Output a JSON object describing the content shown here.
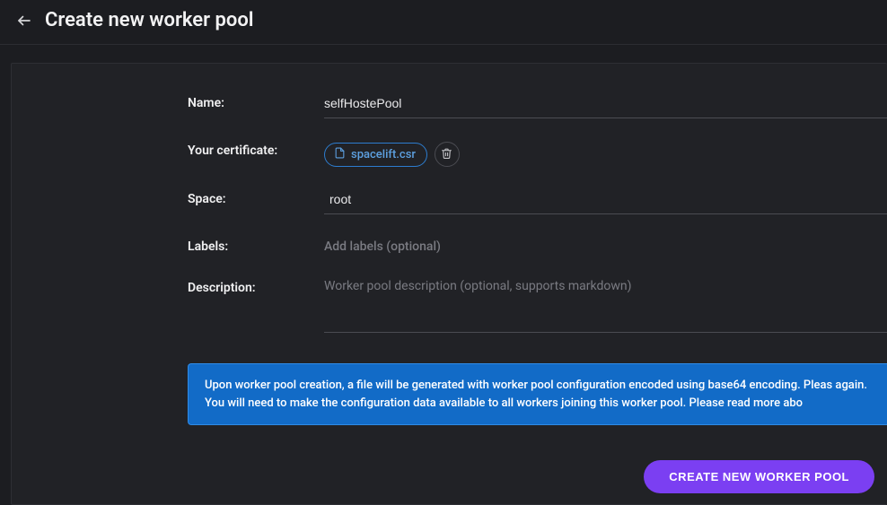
{
  "header": {
    "title": "Create new worker pool"
  },
  "form": {
    "labels": {
      "name": "Name:",
      "certificate": "Your certificate:",
      "space": "Space:",
      "labelsField": "Labels:",
      "description": "Description:"
    },
    "values": {
      "name": "selfHostePool",
      "certificateFile": "spacelift.csr",
      "space": "root"
    },
    "placeholders": {
      "labels": "Add labels (optional)",
      "description": "Worker pool description (optional, supports markdown)"
    }
  },
  "banner": {
    "text": "Upon worker pool creation, a file will be generated with worker pool configuration encoded using base64 encoding. Pleas again. You will need to make the configuration data available to all workers joining this worker pool. Please read more abo"
  },
  "actions": {
    "submit": "CREATE NEW WORKER POOL"
  }
}
